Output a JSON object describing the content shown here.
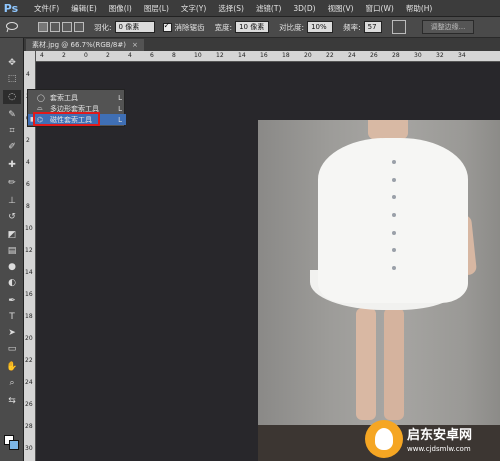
{
  "app": {
    "logo": "Ps"
  },
  "menu": [
    "文件(F)",
    "编辑(E)",
    "图像(I)",
    "图层(L)",
    "文字(Y)",
    "选择(S)",
    "滤镜(T)",
    "3D(D)",
    "视图(V)",
    "窗口(W)",
    "帮助(H)"
  ],
  "options": {
    "feather_label": "羽化:",
    "feather_value": "0 像素",
    "antialias_label": "消除锯齿",
    "width_label": "宽度:",
    "width_value": "10 像素",
    "contrast_label": "对比度:",
    "contrast_value": "10%",
    "frequency_label": "频率:",
    "frequency_value": "57",
    "refine_button": "调整边缘..."
  },
  "document": {
    "tab_title": "素材.jpg @ 66.7%(RGB/8#)",
    "close": "×"
  },
  "rulers": {
    "h_ticks": [
      "4",
      "2",
      "0",
      "2",
      "4",
      "6",
      "8",
      "10",
      "12",
      "14",
      "16",
      "18",
      "20",
      "22",
      "24",
      "26",
      "28",
      "30",
      "32",
      "34"
    ],
    "v_ticks": [
      "4",
      "2",
      "0",
      "2",
      "4",
      "6",
      "8",
      "10",
      "12",
      "14",
      "16",
      "18",
      "20",
      "22",
      "24",
      "26",
      "28",
      "30"
    ]
  },
  "flyout": {
    "items": [
      {
        "label": "套索工具",
        "icon": "lasso-icon",
        "shortcut": "L",
        "selected": false
      },
      {
        "label": "多边形套索工具",
        "icon": "polygonal-lasso-icon",
        "shortcut": "L",
        "selected": false
      },
      {
        "label": "磁性套索工具",
        "icon": "magnetic-lasso-icon",
        "shortcut": "L",
        "selected": true
      }
    ],
    "highlight_color": "#e01b1b",
    "selected_color": "#3f6fb5"
  },
  "colors": {
    "foreground": "#ffffff",
    "background": "#7cb7e8"
  },
  "watermark": {
    "title": "启东安卓网",
    "subtitle": "www.cjdsmlw.com"
  }
}
